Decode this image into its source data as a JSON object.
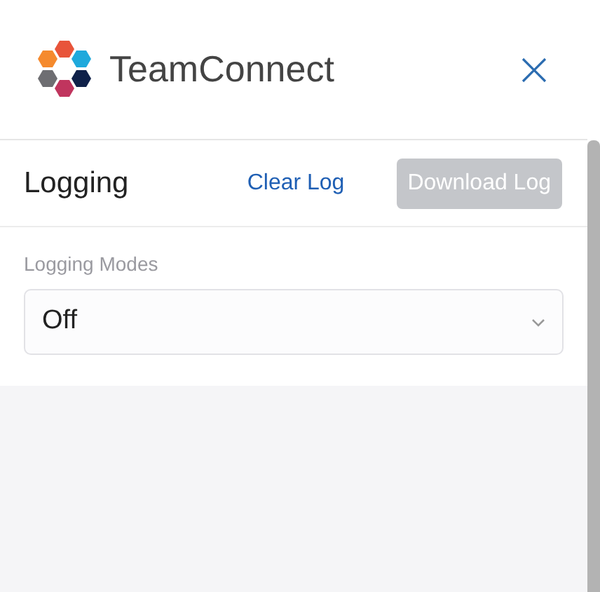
{
  "header": {
    "app_name": "TeamConnect"
  },
  "logging": {
    "title": "Logging",
    "actions": [
      {
        "label": "Clear Log",
        "kind": "link",
        "disabled": false
      },
      {
        "label": "Download Log",
        "kind": "button",
        "disabled": true
      }
    ],
    "mode_field": {
      "label": "Logging Modes",
      "value": "Off"
    }
  }
}
